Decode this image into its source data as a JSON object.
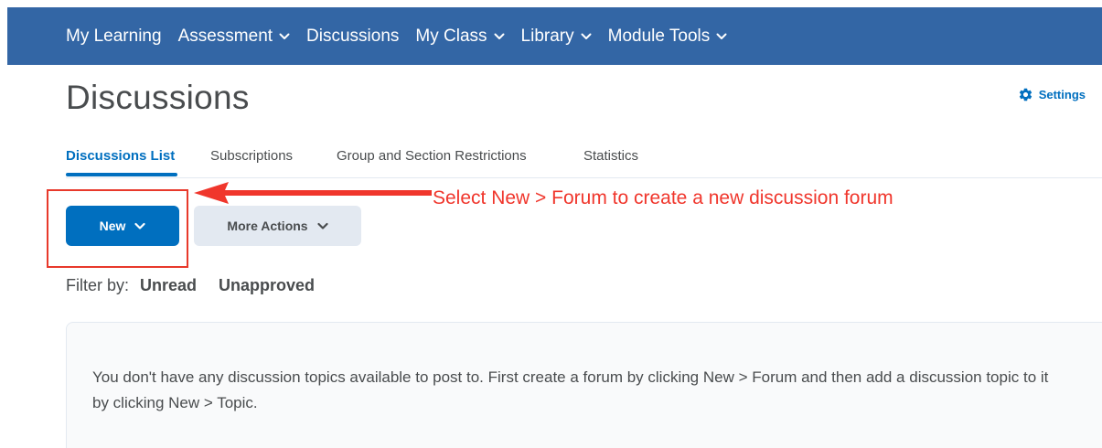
{
  "nav": {
    "items": [
      {
        "label": "My Learning",
        "has_dropdown": false
      },
      {
        "label": "Assessment",
        "has_dropdown": true
      },
      {
        "label": "Discussions",
        "has_dropdown": false
      },
      {
        "label": "My Class",
        "has_dropdown": true
      },
      {
        "label": "Library",
        "has_dropdown": true
      },
      {
        "label": "Module Tools",
        "has_dropdown": true
      }
    ]
  },
  "page": {
    "title": "Discussions",
    "settings_label": "Settings"
  },
  "tabs": [
    {
      "label": "Discussions List",
      "active": true
    },
    {
      "label": "Subscriptions",
      "active": false
    },
    {
      "label": "Group and Section Restrictions",
      "active": false
    },
    {
      "label": "Statistics",
      "active": false
    }
  ],
  "toolbar": {
    "new_label": "New",
    "more_actions_label": "More Actions"
  },
  "annotation": {
    "callout_text": "Select New > Forum to create a new discussion forum"
  },
  "filter": {
    "label": "Filter by:",
    "options": [
      "Unread",
      "Unapproved"
    ]
  },
  "empty_state": {
    "message": "You don't have any discussion topics available to post to. First create a forum by clicking New > Forum and then add a discussion topic to it by clicking New > Topic."
  },
  "colors": {
    "nav_bar": "#3366a5",
    "primary": "#006fbf",
    "annotation_red": "#e8392b",
    "secondary_button": "#e3e9f1"
  },
  "icons": {
    "settings": "gear-icon",
    "dropdown": "chevron-down-icon",
    "callout": "arrow-left-icon"
  }
}
